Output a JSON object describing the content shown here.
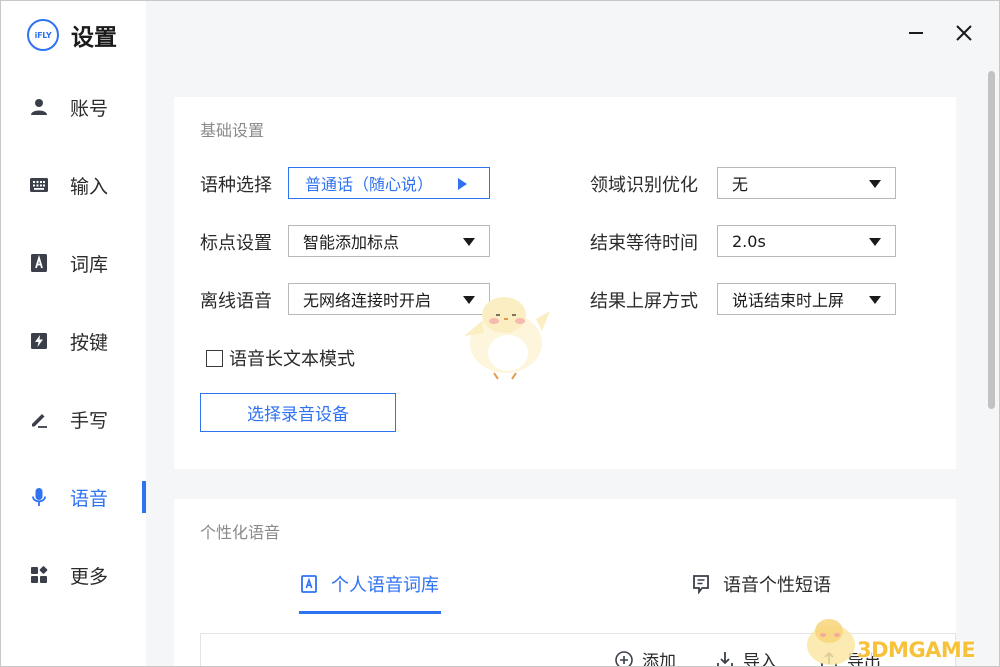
{
  "app": {
    "logo_text": "iFLY",
    "title": "设置"
  },
  "sidebar": {
    "items": [
      {
        "label": "账号",
        "icon": "user-icon"
      },
      {
        "label": "输入",
        "icon": "keyboard-icon"
      },
      {
        "label": "词库",
        "icon": "dictionary-icon"
      },
      {
        "label": "按键",
        "icon": "key-icon"
      },
      {
        "label": "手写",
        "icon": "pen-icon"
      },
      {
        "label": "语音",
        "icon": "microphone-icon",
        "active": true
      },
      {
        "label": "更多",
        "icon": "apps-grid-icon"
      }
    ]
  },
  "window_controls": {
    "minimize": "minimize-icon",
    "close": "close-icon"
  },
  "basic_settings": {
    "title": "基础设置",
    "language_label": "语种选择",
    "language_value": "普通话（随心说）",
    "punctuation_label": "标点设置",
    "punctuation_value": "智能添加标点",
    "offline_label": "离线语音",
    "offline_value": "无网络连接时开启",
    "domain_label": "领域识别优化",
    "domain_value": "无",
    "wait_label": "结束等待时间",
    "wait_value": "2.0s",
    "commit_label": "结果上屏方式",
    "commit_value": "说话结束时上屏",
    "long_text_label": "语音长文本模式",
    "long_text_checked": false,
    "record_device_button": "选择录音设备"
  },
  "personal_voice": {
    "title": "个性化语音",
    "tab_dictionary": "个人语音词库",
    "tab_phrases": "语音个性短语",
    "tool_add": "添加",
    "tool_import": "导入",
    "tool_export": "导出"
  },
  "watermark": {
    "text": "3DMGAME"
  },
  "colors": {
    "accent": "#2f72f2",
    "sidebar_bg": "#ffffff",
    "content_bg": "#f5f6f8",
    "watermark": "#f7c23a"
  }
}
